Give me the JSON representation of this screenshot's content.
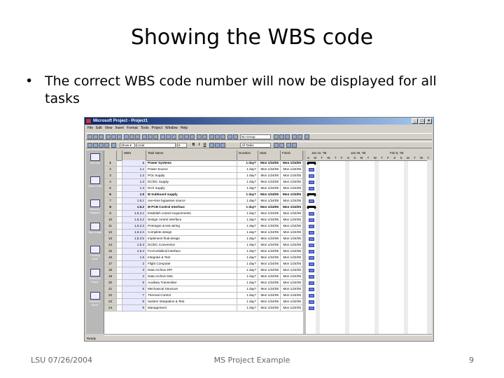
{
  "slide": {
    "title": "Showing the WBS code",
    "bullet_symbol": "•",
    "bullet": "The correct WBS code number will now be displayed for all tasks",
    "footer_left": "LSU 07/26/2004",
    "footer_center": "MS Project Example",
    "page_number": "9"
  },
  "window": {
    "title": "Microsoft Project - Project1",
    "menu": [
      "File",
      "Edit",
      "View",
      "Insert",
      "Format",
      "Tools",
      "Project",
      "Window",
      "Help"
    ],
    "group_select": "No Group",
    "show_label": "Show ▾",
    "font_select": "Arial",
    "font_size": "8",
    "filter_select": "All Tasks",
    "status": "Ready"
  },
  "viewbar": [
    "Calendar",
    "Gantt Chart",
    "Network Diagram",
    "Task Usage",
    "Tracking Gantt",
    "Resource Graph",
    "Resource Sheet"
  ],
  "columns": {
    "wbs": "WBS",
    "name": "Task Name",
    "duration": "Duration",
    "start": "Start",
    "finish": "Finish"
  },
  "gantt_header": {
    "week1": "Jan 22, '05",
    "week2": "Jan 29, '05",
    "week3": "Feb 5, '05",
    "days": "S M T W T F S S M T W T F S S M T W T F S"
  },
  "tasks": [
    {
      "id": "1",
      "wbs": "1",
      "name": "Power Systems",
      "duration": "1 day?",
      "start": "Mon 1/24/05",
      "finish": "Mon 1/24/05",
      "summary": true
    },
    {
      "id": "2",
      "wbs": "1.1",
      "name": "Power Source",
      "duration": "1 day?",
      "start": "Mon 1/24/05",
      "finish": "Mon 1/24/05"
    },
    {
      "id": "3",
      "wbs": "1.2",
      "name": "POL Supply",
      "duration": "1 day?",
      "start": "Mon 1/24/05",
      "finish": "Mon 1/24/05"
    },
    {
      "id": "4",
      "wbs": "1.3",
      "name": "DC/DC Supply",
      "duration": "1 day?",
      "start": "Mon 1/24/05",
      "finish": "Mon 1/24/05"
    },
    {
      "id": "5",
      "wbs": "1.4",
      "name": "DC/I Supply",
      "duration": "1 day?",
      "start": "Mon 1/24/05",
      "finish": "Mon 1/24/05"
    },
    {
      "id": "6",
      "wbs": "1.5",
      "name": "⊟ Subboard supply",
      "duration": "1 day?",
      "start": "Mon 1/24/05",
      "finish": "Mon 1/24/05",
      "summary": true
    },
    {
      "id": "7",
      "wbs": "1.5.1",
      "name": "one-time bypasses source",
      "duration": "1 day?",
      "start": "Mon 1/24/05",
      "finish": "Mon 1/24/05"
    },
    {
      "id": "8",
      "wbs": "1.5.2",
      "name": "⊟ PCB Control Interface",
      "duration": "1 day?",
      "start": "Mon 1/24/05",
      "finish": "Mon 1/24/05",
      "summary": true
    },
    {
      "id": "9",
      "wbs": "1.5.2.1",
      "name": "Establish control requirements",
      "duration": "1 day?",
      "start": "Mon 1/24/05",
      "finish": "Mon 1/24/05"
    },
    {
      "id": "10",
      "wbs": "1.5.2.2",
      "name": "Design control interface",
      "duration": "1 day?",
      "start": "Mon 1/24/05",
      "finish": "Mon 1/24/05"
    },
    {
      "id": "11",
      "wbs": "1.5.2.3",
      "name": "Prototype & test wiring",
      "duration": "1 day?",
      "start": "Mon 1/24/05",
      "finish": "Mon 1/24/05"
    },
    {
      "id": "12",
      "wbs": "1.5.2.4",
      "name": "Complete design",
      "duration": "1 day?",
      "start": "Mon 1/24/05",
      "finish": "Mon 1/24/05"
    },
    {
      "id": "13",
      "wbs": "1.5.2.5",
      "name": "Implement final design",
      "duration": "1 day?",
      "start": "Mon 1/24/05",
      "finish": "Mon 1/24/05"
    },
    {
      "id": "14",
      "wbs": "1.5.3",
      "name": "DC/DC Conversion",
      "duration": "1 day?",
      "start": "Mon 1/24/05",
      "finish": "Mon 1/24/05"
    },
    {
      "id": "15",
      "wbs": "1.5.4",
      "name": "FLV/Umbilical interface",
      "duration": "1 day?",
      "start": "Mon 1/24/05",
      "finish": "Mon 1/24/05"
    },
    {
      "id": "16",
      "wbs": "1.6",
      "name": "Integrate & Test",
      "duration": "1 day?",
      "start": "Mon 1/24/05",
      "finish": "Mon 1/24/05"
    },
    {
      "id": "17",
      "wbs": "2",
      "name": "Flight Computer",
      "duration": "1 day?",
      "start": "Mon 1/24/05",
      "finish": "Mon 1/24/05"
    },
    {
      "id": "18",
      "wbs": "3",
      "name": "Data Archive DPI",
      "duration": "1 day?",
      "start": "Mon 1/24/05",
      "finish": "Mon 1/24/05"
    },
    {
      "id": "19",
      "wbs": "4",
      "name": "Data Archive Disc",
      "duration": "1 day?",
      "start": "Mon 1/24/05",
      "finish": "Mon 1/24/05"
    },
    {
      "id": "20",
      "wbs": "5",
      "name": "Auxiliary Transmitter",
      "duration": "1 day?",
      "start": "Mon 1/24/05",
      "finish": "Mon 1/24/05"
    },
    {
      "id": "21",
      "wbs": "6",
      "name": "Mechanical Structure",
      "duration": "1 day?",
      "start": "Mon 1/24/05",
      "finish": "Mon 1/24/05"
    },
    {
      "id": "22",
      "wbs": "7",
      "name": "Thermal Control",
      "duration": "1 day?",
      "start": "Mon 1/24/05",
      "finish": "Mon 1/24/05"
    },
    {
      "id": "23",
      "wbs": "8",
      "name": "System Integration & Test",
      "duration": "1 day?",
      "start": "Mon 1/24/05",
      "finish": "Mon 1/24/05"
    },
    {
      "id": "24",
      "wbs": "9",
      "name": "Management",
      "duration": "1 day?",
      "start": "Mon 1/24/05",
      "finish": "Mon 1/24/05"
    }
  ]
}
